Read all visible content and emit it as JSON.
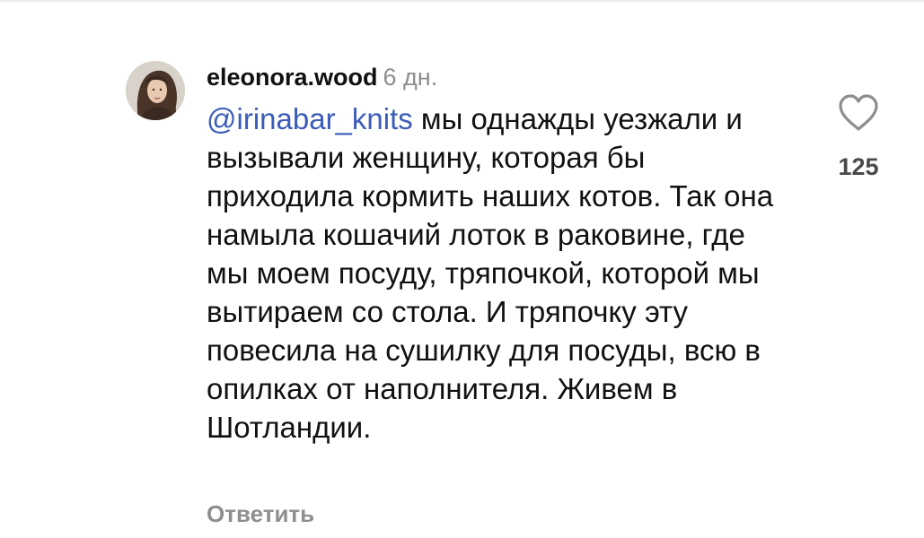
{
  "comment": {
    "username": "eleonora.wood",
    "timestamp": "6 дн.",
    "mention": "@irinabar_knits",
    "text": " мы однажды уезжали и вызывали женщину, которая бы приходила кормить наших котов. Так она намыла кошачий лоток в раковине, где мы моем посуду, тряпочкой, которой мы вытираем со стола. И тряпочку эту повесила на сушилку для посуды, всю в опилках от наполнителя. Живем в Шотландии.",
    "reply_label": "Ответить",
    "like_count": "125"
  },
  "colors": {
    "mention": "#3b5cb8",
    "secondary_text": "#8e8e8e",
    "primary_text": "#111111",
    "like_icon_stroke": "#8e8e8e"
  },
  "icons": {
    "like": "heart-outline-icon",
    "avatar": "user-avatar"
  }
}
